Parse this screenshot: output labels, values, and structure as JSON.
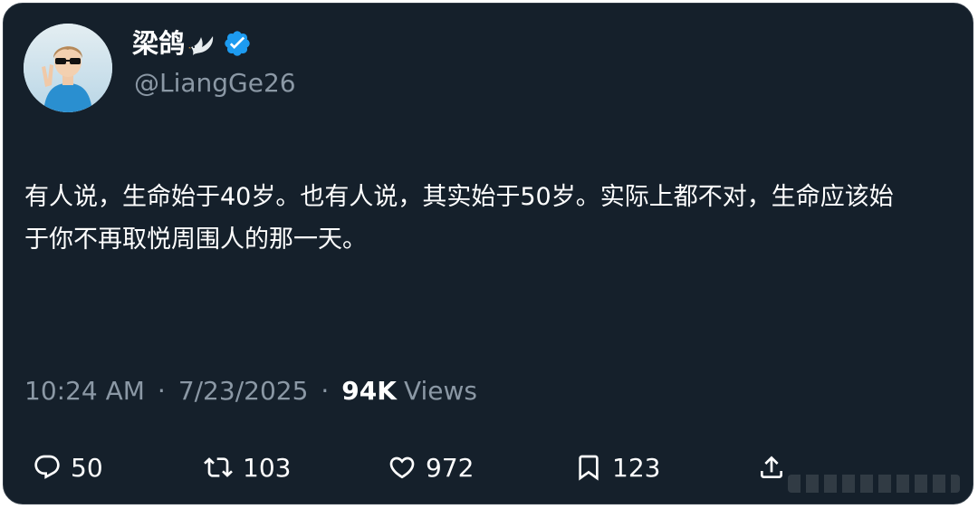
{
  "tweet": {
    "author": {
      "display_name": "梁鸽",
      "handle": "@LiangGe26",
      "verified": true,
      "avatar_icon": "avatar-photo"
    },
    "text_lines": [
      "有人说，生命始于40岁。也有人说，其实始于50岁。实际上都不对，生命应该始",
      "于你不再取悦周围人的那一天。"
    ],
    "time": "10:24 AM",
    "date": "7/23/2025",
    "separator": "·",
    "views_count": "94K",
    "views_label": "Views"
  },
  "actions": {
    "reply": {
      "icon": "reply-icon",
      "count": "50"
    },
    "retweet": {
      "icon": "retweet-icon",
      "count": "103"
    },
    "like": {
      "icon": "heart-icon",
      "count": "972"
    },
    "bookmark": {
      "icon": "bookmark-icon",
      "count": "123"
    },
    "share": {
      "icon": "share-icon"
    }
  },
  "colors": {
    "background": "#15202b",
    "text_primary": "#ffffff",
    "text_secondary": "#8b98a5",
    "verified_badge": "#1d9bf0"
  }
}
